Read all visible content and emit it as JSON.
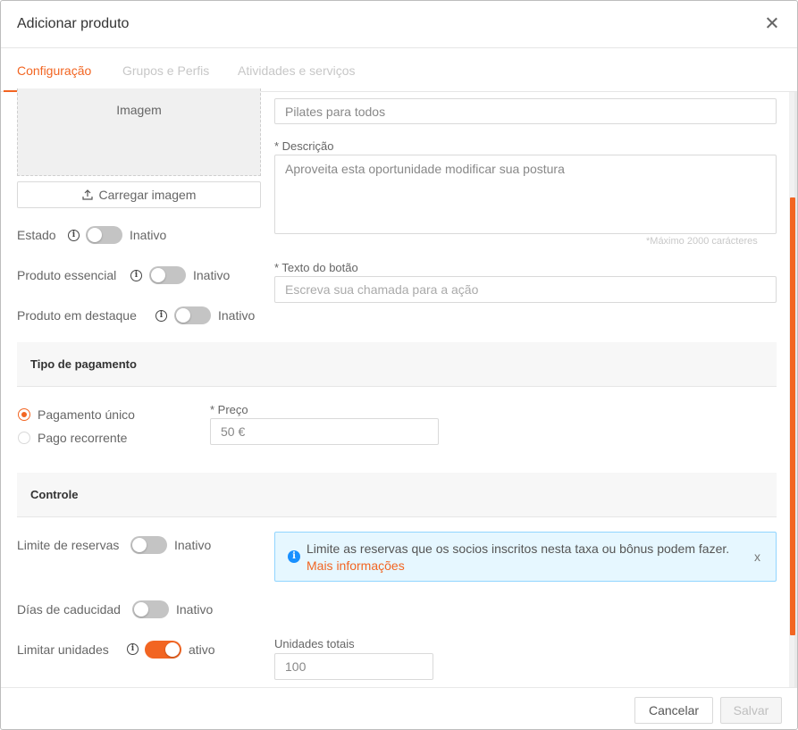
{
  "header": {
    "title": "Adicionar produto"
  },
  "tabs": [
    {
      "label": "Configuração",
      "active": true
    },
    {
      "label": "Grupos e Perfis",
      "active": false
    },
    {
      "label": "Atividades e serviços",
      "active": false
    }
  ],
  "image": {
    "placeholder_label": "Imagem",
    "upload_label": "Carregar imagem"
  },
  "status_fields": [
    {
      "label": "Estado",
      "state_label": "Inativo",
      "on": false
    },
    {
      "label": "Produto essencial",
      "state_label": "Inativo",
      "on": false
    },
    {
      "label": "Produto em destaque",
      "state_label": "Inativo",
      "on": false
    }
  ],
  "form": {
    "name_value": "Pilates para todos",
    "description_label": "* Descrição",
    "description_value": "Aproveita esta oportunidade modificar sua postura",
    "description_hint": "*Máximo 2000 carácteres",
    "button_text_label": "* Texto do botão",
    "button_text_placeholder": "Escreva sua chamada para a ação"
  },
  "payment": {
    "section_title": "Tipo de pagamento",
    "options": [
      {
        "label": "Pagamento único",
        "checked": true
      },
      {
        "label": "Pago recorrente",
        "checked": false
      }
    ],
    "price_label": "* Preço",
    "price_value": "50 €"
  },
  "control": {
    "section_title": "Controle",
    "booking_limit": {
      "label": "Limite de reservas",
      "state_label": "Inativo",
      "on": false
    },
    "expiry_days": {
      "label": "Días de caducidad",
      "state_label": "Inativo",
      "on": false
    },
    "limit_units": {
      "label": "Limitar unidades",
      "state_label": "ativo",
      "on": true
    },
    "alert_text": "Limite as reservas que os socios inscritos nesta taxa ou bônus podem fazer.",
    "alert_link": "Mais informações",
    "alert_close": "x",
    "total_units_label": "Unidades totais",
    "total_units_value": "100"
  },
  "footer": {
    "cancel_label": "Cancelar",
    "save_label": "Salvar"
  },
  "colors": {
    "accent": "#f26522",
    "toggle_off": "#c4c4c4",
    "info_bg": "#e6f7ff",
    "info_border": "#91d5ff",
    "info_icon": "#1890ff"
  }
}
